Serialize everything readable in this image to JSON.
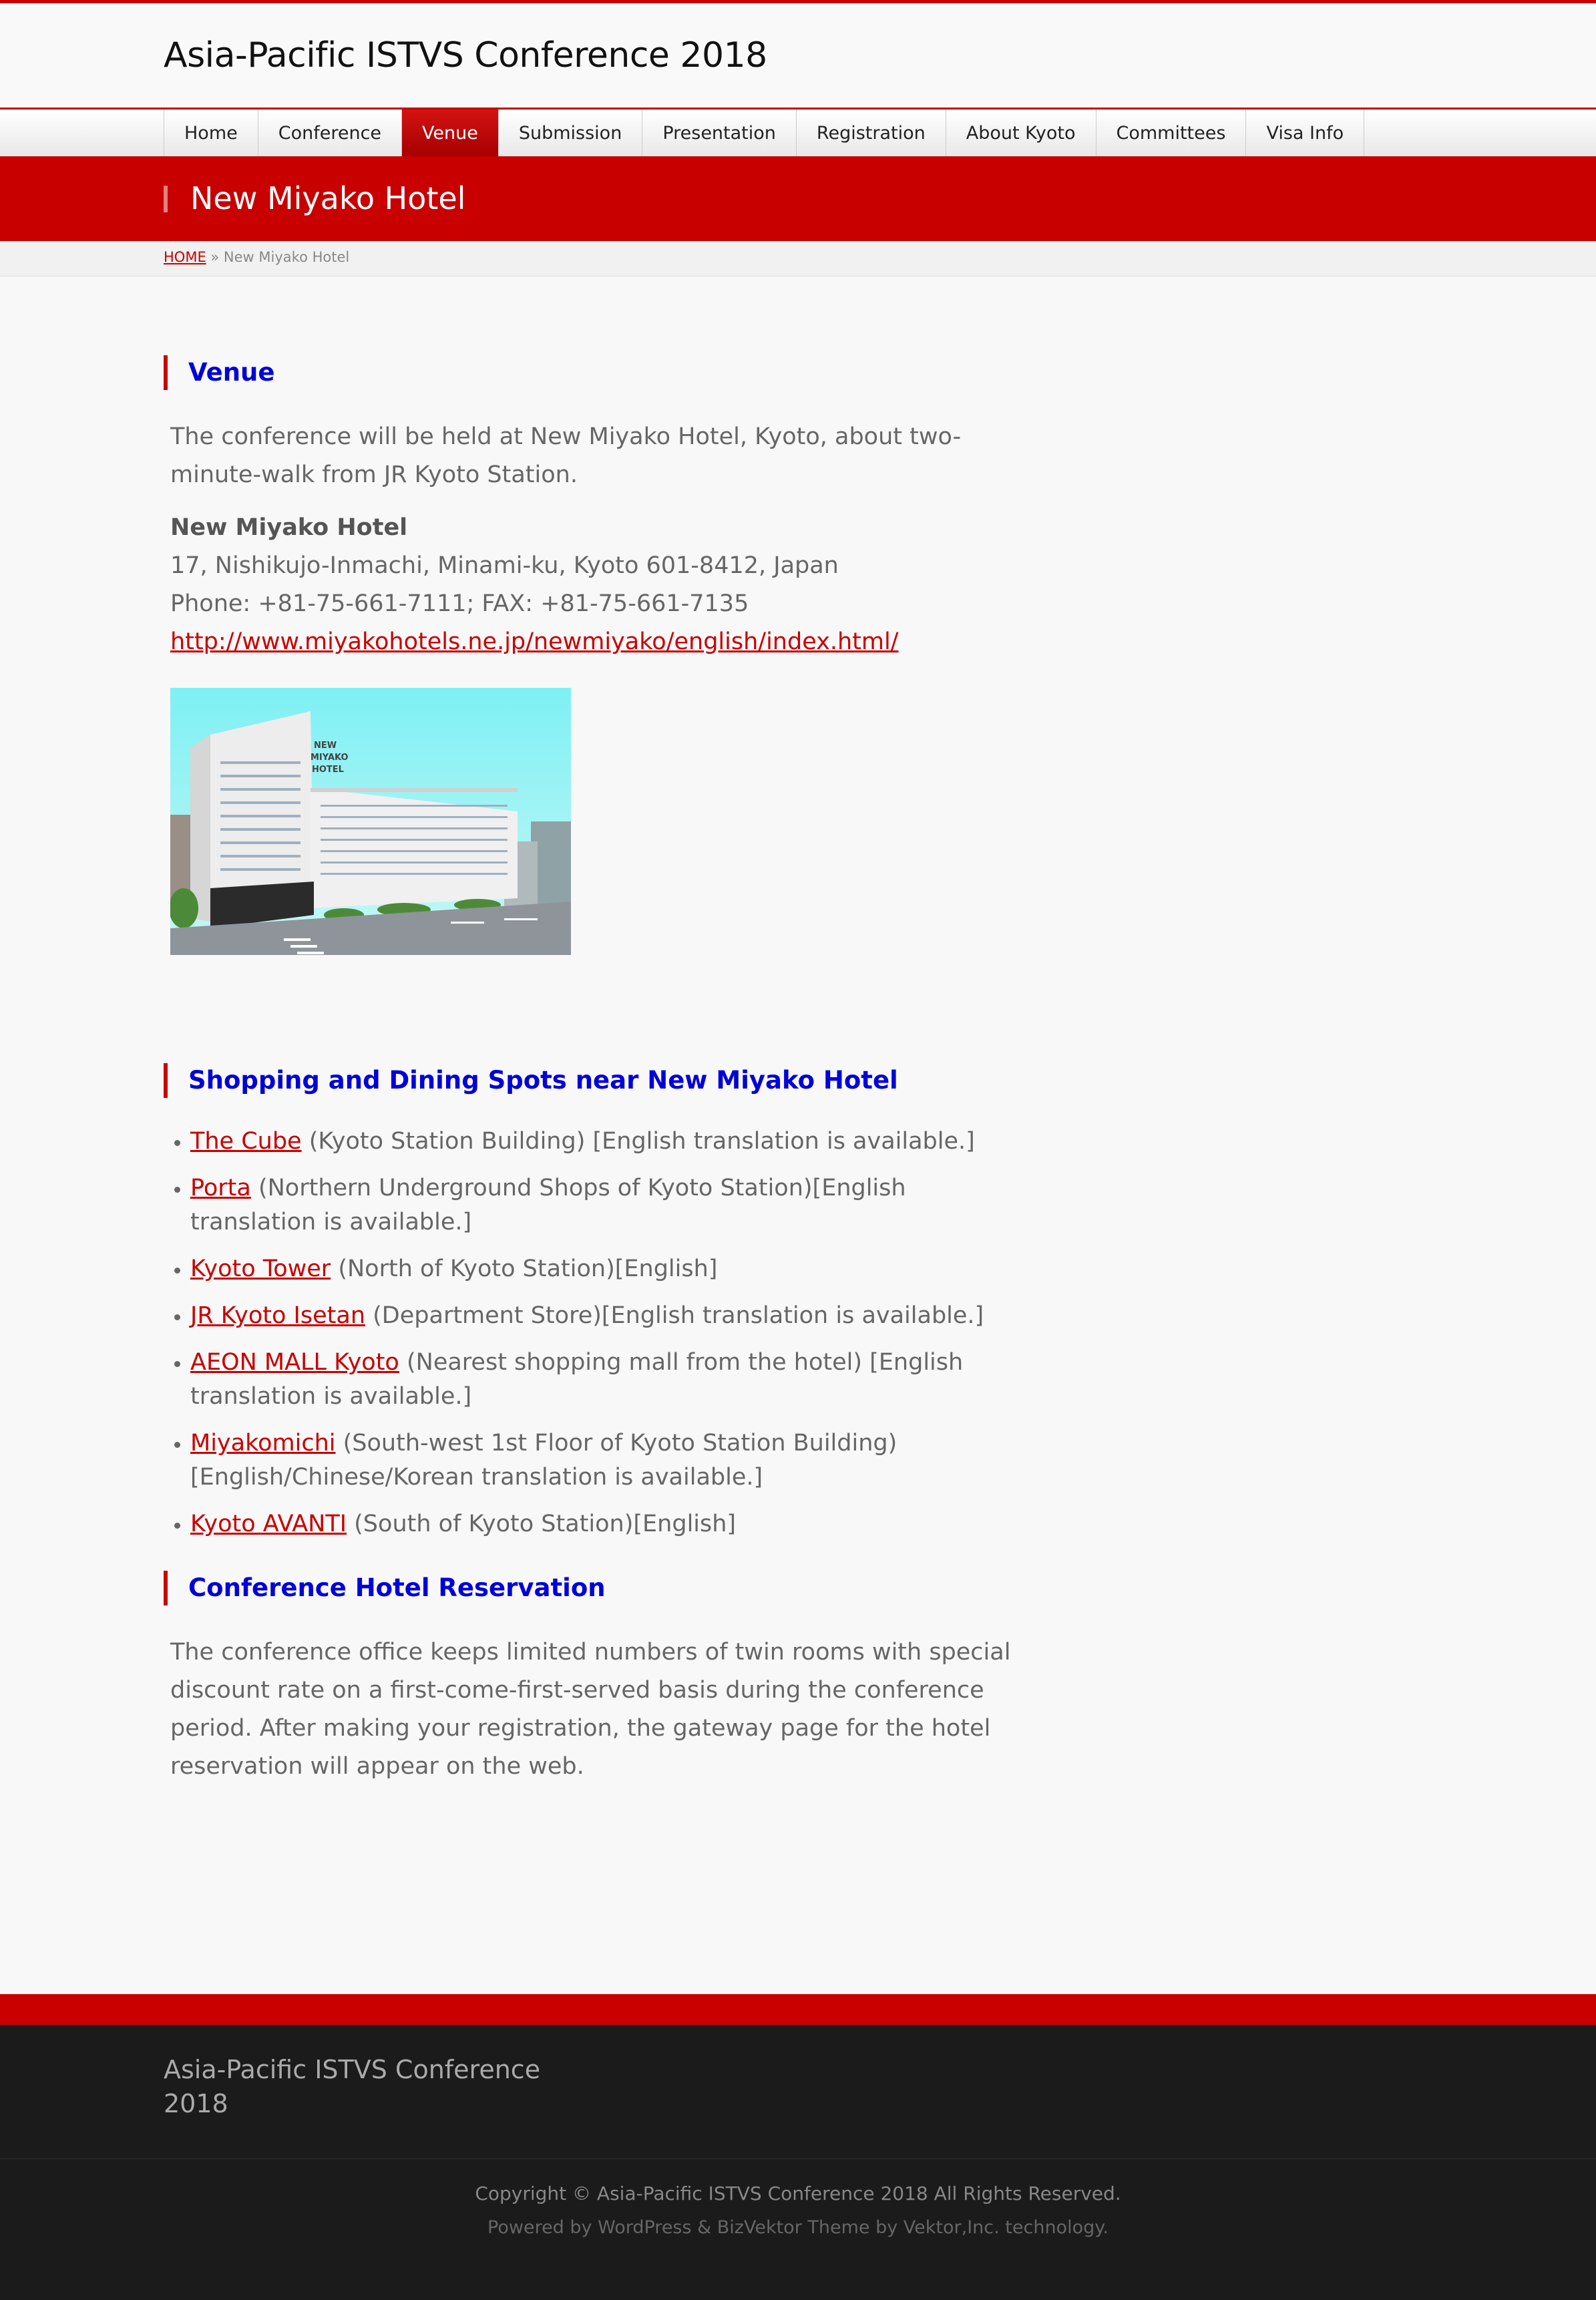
{
  "site": {
    "title": "Asia-Pacific ISTVS Conference 2018"
  },
  "nav": [
    {
      "label": "Home"
    },
    {
      "label": "Conference"
    },
    {
      "label": "Venue",
      "active": true
    },
    {
      "label": "Submission"
    },
    {
      "label": "Presentation"
    },
    {
      "label": "Registration"
    },
    {
      "label": "About Kyoto"
    },
    {
      "label": "Committees"
    },
    {
      "label": "Visa Info"
    }
  ],
  "page_title": "New Miyako Hotel",
  "breadcrumb": {
    "home": "HOME",
    "sep": " » ",
    "current": "New Miyako Hotel"
  },
  "venue": {
    "heading": "Venue",
    "intro": "The conference will be held at New Miyako Hotel, Kyoto, about two-minute-walk from JR Kyoto Station.",
    "hotel_name": "New Miyako Hotel",
    "address": "17, Nishikujo-Inmachi, Minami-ku, Kyoto 601-8412, Japan",
    "phone": "Phone: +81-75-661-7111; FAX: +81-75-661-7135",
    "url": "http://www.miyakohotels.ne.jp/newmiyako/english/index.html/",
    "photo_sign": "NEW MIYAKO HOTEL"
  },
  "shopping": {
    "heading": "Shopping and Dining Spots near New Miyako Hotel",
    "items": [
      {
        "link": "The Cube",
        "desc": " (Kyoto Station Building) [English translation is available.]"
      },
      {
        "link": "Porta",
        "desc": " (Northern Underground Shops of Kyoto Station)[English translation is available.]"
      },
      {
        "link": "Kyoto Tower",
        "desc": " (North of Kyoto Station)[English]"
      },
      {
        "link": "JR Kyoto Isetan",
        "desc": " (Department Store)[English translation is available.]"
      },
      {
        "link": "AEON MALL Kyoto",
        "desc": " (Nearest shopping mall from the hotel) [English translation is available.]"
      },
      {
        "link": "Miyakomichi",
        "desc": " (South-west 1st Floor of Kyoto Station Building) [English/Chinese/Korean translation is available.]"
      },
      {
        "link": "Kyoto AVANTI",
        "desc": " (South of Kyoto Station)[English]"
      }
    ]
  },
  "reservation": {
    "heading": "Conference Hotel Reservation",
    "text": "The conference office keeps limited numbers of twin rooms with special discount rate on a first-come-first-served basis during the conference period.  After making your registration, the gateway page for the hotel reservation will appear on the web."
  },
  "footer": {
    "name": "Asia-Pacific ISTVS Conference 2018",
    "copyright": "Copyright © Asia-Pacific ISTVS Conference 2018 All Rights Reserved.",
    "powered": "Powered by WordPress & BizVektor Theme by Vektor,Inc. technology."
  },
  "colors": {
    "accent": "#c80000",
    "heading": "#0000d9",
    "footer_bg": "#1b1b1b"
  }
}
